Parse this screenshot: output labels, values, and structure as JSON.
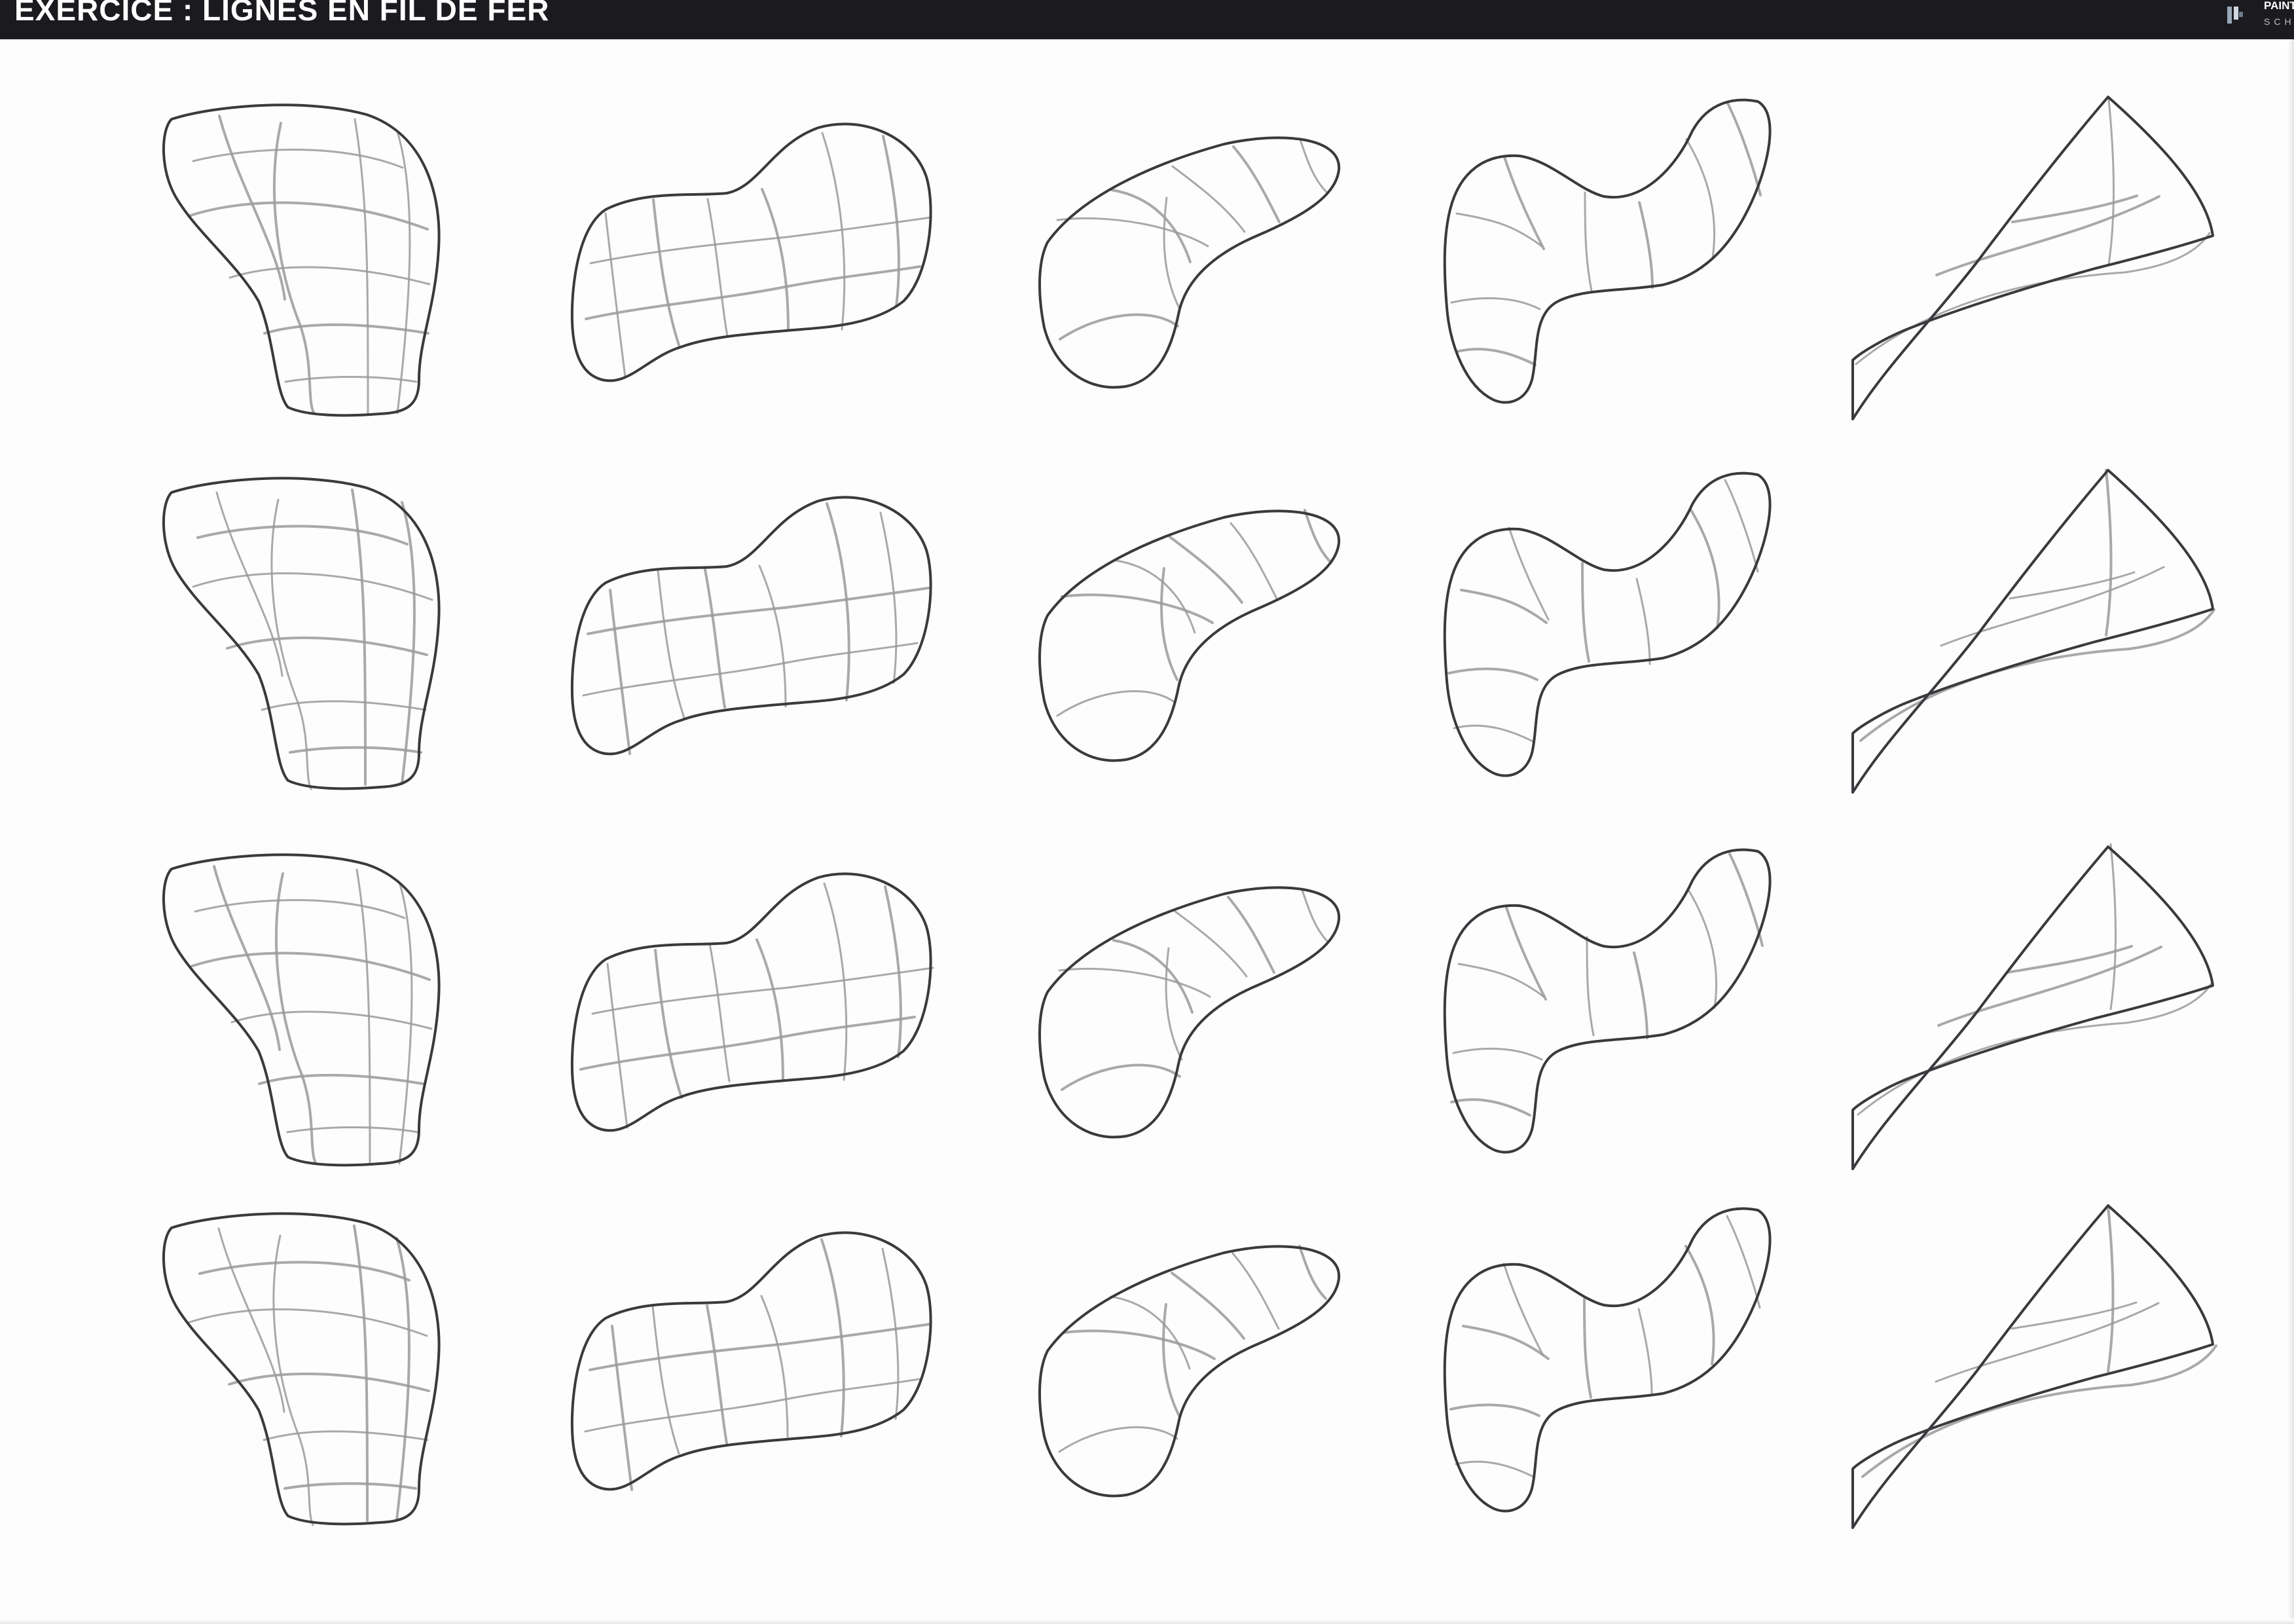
{
  "header": {
    "title": "EXERCICE : LIGNES EN FIL DE FER",
    "logo_line1": "PAINT",
    "logo_line2": "SCHO"
  },
  "drawing": {
    "rows": 4,
    "columns": 5,
    "colors": {
      "header": "#1b1b1f",
      "outline": "#3a3a3e",
      "wire": "#9a9a9a",
      "paper": "#fdfdfd"
    },
    "shapes": [
      "bell-blob",
      "dumbbell-blob",
      "bean-blob",
      "hook-blob",
      "curved-triangle"
    ]
  }
}
